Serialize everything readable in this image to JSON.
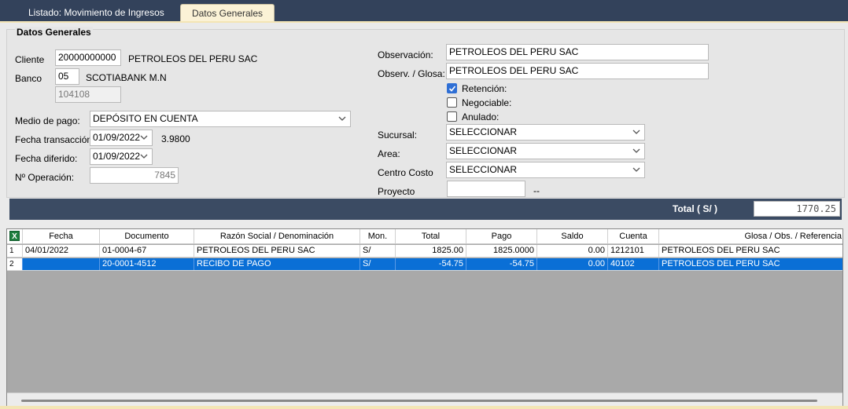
{
  "tabs": [
    {
      "label": "Listado: Movimiento de Ingresos"
    },
    {
      "label": "Datos Generales"
    }
  ],
  "group_title": "Datos Generales",
  "form": {
    "cliente_label": "Cliente",
    "cliente_code": "20000000000",
    "cliente_name": "PETROLEOS DEL PERU SAC",
    "banco_label": "Banco",
    "banco_code": "05",
    "banco_name": "SCOTIABANK M.N",
    "banco_account": "104108",
    "medio_pago_label": "Medio de pago:",
    "medio_pago_value": "DEPÓSITO EN CUENTA",
    "fecha_transaccion_label": "Fecha transacción:",
    "fecha_transaccion_value": "01/09/2022",
    "tipo_cambio": "3.9800",
    "fecha_diferido_label": "Fecha diferido:",
    "fecha_diferido_value": "01/09/2022",
    "operacion_label": "Nº Operación:",
    "operacion_value": "7845",
    "observacion_label": "Observación:",
    "observacion_value": "PETROLEOS DEL PERU SAC",
    "glosa_label": "Observ. / Glosa:",
    "glosa_value": "PETROLEOS DEL PERU SAC",
    "retencion_label": "Retención:",
    "retencion_checked": true,
    "negociable_label": "Negociable:",
    "negociable_checked": false,
    "anulado_label": "Anulado:",
    "anulado_checked": false,
    "sucursal_label": "Sucursal:",
    "sucursal_value": "SELECCIONAR",
    "area_label": "Area:",
    "area_value": "SELECCIONAR",
    "centro_costo_label": "Centro Costo",
    "centro_costo_value": "SELECCIONAR",
    "proyecto_label": "Proyecto",
    "proyecto_value": "",
    "proyecto_suffix": "--"
  },
  "total": {
    "label": "Total ( S/ )",
    "value": "1770.25"
  },
  "grid": {
    "export_icon": "excel-icon",
    "columns": [
      "Fecha",
      "Documento",
      "Razón Social / Denominación",
      "Mon.",
      "Total",
      "Pago",
      "Saldo",
      "Cuenta",
      "Glosa / Obs. / Referencia"
    ],
    "rows": [
      {
        "num": "1",
        "fecha": "04/01/2022",
        "documento": "01-0004-67",
        "razon": "PETROLEOS DEL PERU SAC",
        "mon": "S/",
        "total": "1825.00",
        "pago": "1825.0000",
        "saldo": "0.00",
        "cuenta": "1212101",
        "glosa": "PETROLEOS DEL PERU SAC"
      },
      {
        "num": "2",
        "fecha": "",
        "documento": "20-0001-4512",
        "razon": "RECIBO DE PAGO",
        "mon": "S/",
        "total": "-54.75",
        "pago": "-54.75",
        "saldo": "0.00",
        "cuenta": "40102",
        "glosa": "PETROLEOS DEL PERU SAC"
      }
    ]
  },
  "colors": {
    "header_bg": "#33425b",
    "selected_row": "#0a6fd6",
    "active_tab": "#fbf2d6",
    "checkbox_checked": "#2f6fd5"
  }
}
